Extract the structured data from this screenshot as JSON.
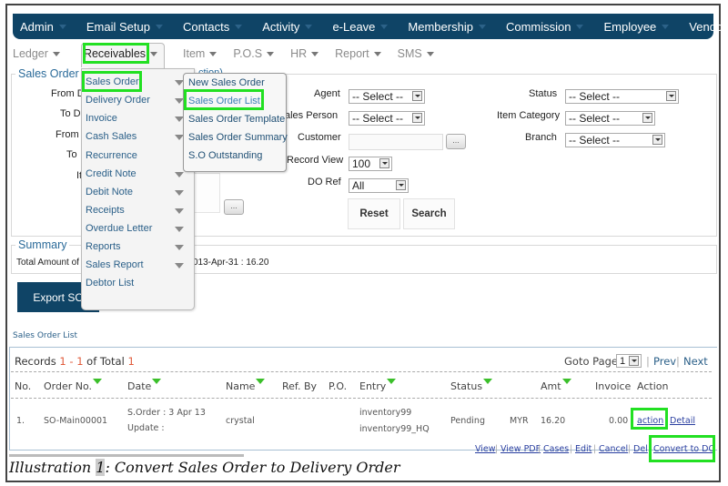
{
  "topnav": [
    {
      "label": "Admin"
    },
    {
      "label": "Email Setup"
    },
    {
      "label": "Contacts"
    },
    {
      "label": "Activity"
    },
    {
      "label": "e-Leave"
    },
    {
      "label": "Membership"
    },
    {
      "label": "Commission"
    },
    {
      "label": "Employee"
    },
    {
      "label": "Vendor"
    }
  ],
  "subnav": [
    {
      "label": "Ledger"
    },
    {
      "label": "Receivables"
    },
    {
      "label": "Item"
    },
    {
      "label": "P.O.S"
    },
    {
      "label": "HR"
    },
    {
      "label": "Report"
    },
    {
      "label": "SMS"
    }
  ],
  "receivables_menu": [
    {
      "label": "Sales Order",
      "has_sub": true
    },
    {
      "label": "Delivery Order",
      "has_sub": true
    },
    {
      "label": "Invoice",
      "has_sub": true
    },
    {
      "label": "Cash Sales",
      "has_sub": true
    },
    {
      "label": "Recurrence",
      "has_sub": false
    },
    {
      "label": "Credit Note",
      "has_sub": true
    },
    {
      "label": "Debit Note",
      "has_sub": true
    },
    {
      "label": "Receipts",
      "has_sub": true
    },
    {
      "label": "Overdue Letter",
      "has_sub": true
    },
    {
      "label": "Reports",
      "has_sub": true
    },
    {
      "label": "Sales Report",
      "has_sub": true
    },
    {
      "label": "Debtor List",
      "has_sub": false
    }
  ],
  "sales_order_submenu": [
    {
      "label": "New Sales Order"
    },
    {
      "label": "Sales Order List"
    },
    {
      "label": "Sales Order Template"
    },
    {
      "label": "Sales Order Summary"
    },
    {
      "label": "S.O Outstanding"
    }
  ],
  "search": {
    "legend": "Sales Order (",
    "legend_tail": "ction)",
    "left_labels": [
      "From D",
      "To D",
      "From",
      "To",
      "It"
    ],
    "agent_label": "Agent",
    "agent_value": "-- Select --",
    "sales_person_label": "ales Person",
    "sales_person_value": "-- Select --",
    "customer_label": "Customer",
    "customer_value": "",
    "customer_browse": "...",
    "record_view_label": "Record View",
    "record_view_value": "100",
    "do_ref_label": "DO Ref",
    "do_ref_value": "All",
    "status_label": "Status",
    "status_value": "-- Select --",
    "item_category_label": "Item Category",
    "item_category_value": "-- Select --",
    "branch_label": "Branch",
    "branch_value": "-- Select --",
    "item_browse": "...",
    "reset_label": "Reset",
    "search_label": "Search"
  },
  "summary": {
    "legend": "Summary",
    "text_left": "Total Amount of",
    "text_right": "013-Apr-31 : 16.20"
  },
  "export_label": "Export SO",
  "list": {
    "title": "Sales Order List",
    "records_prefix": "Records",
    "records_from": "1",
    "records_dash": "-",
    "records_to": "1",
    "records_of": "of Total",
    "records_total": "1",
    "goto_label": "Goto Page",
    "goto_value": "1",
    "prev": "Prev",
    "next": "Next",
    "columns": [
      "No.",
      "Order No.",
      "Date",
      "Name",
      "Ref. By",
      "P.O.",
      "Entry",
      "Status",
      "Amt",
      "Invoice",
      "Action"
    ],
    "rows": [
      {
        "no": "1.",
        "order_no": "SO-Main00001",
        "date_line1": "S.Order : 3 Apr 13",
        "date_line2": "Update :",
        "name": "crystal",
        "entry_line1": "inventory99",
        "entry_line2": "inventory99_HQ",
        "status": "Pending",
        "currency": "MYR",
        "amount": "16.20",
        "invoice": "0.00",
        "action": "action",
        "detail": "Detail",
        "links": [
          "View",
          "View PDF",
          "Cases",
          "Edit",
          "Cancel",
          "Del"
        ],
        "convert": "Convert to DO"
      }
    ]
  },
  "caption": {
    "prefix": "Illustration",
    "num": "1",
    "text": ": Convert Sales Order to Delivery Order"
  },
  "colors": {
    "nav_bg": "#0f4466",
    "highlight": "#22e022",
    "link": "#2a3fa0",
    "accent_red": "#e05a3a",
    "sort_green": "#3bbf2a"
  }
}
